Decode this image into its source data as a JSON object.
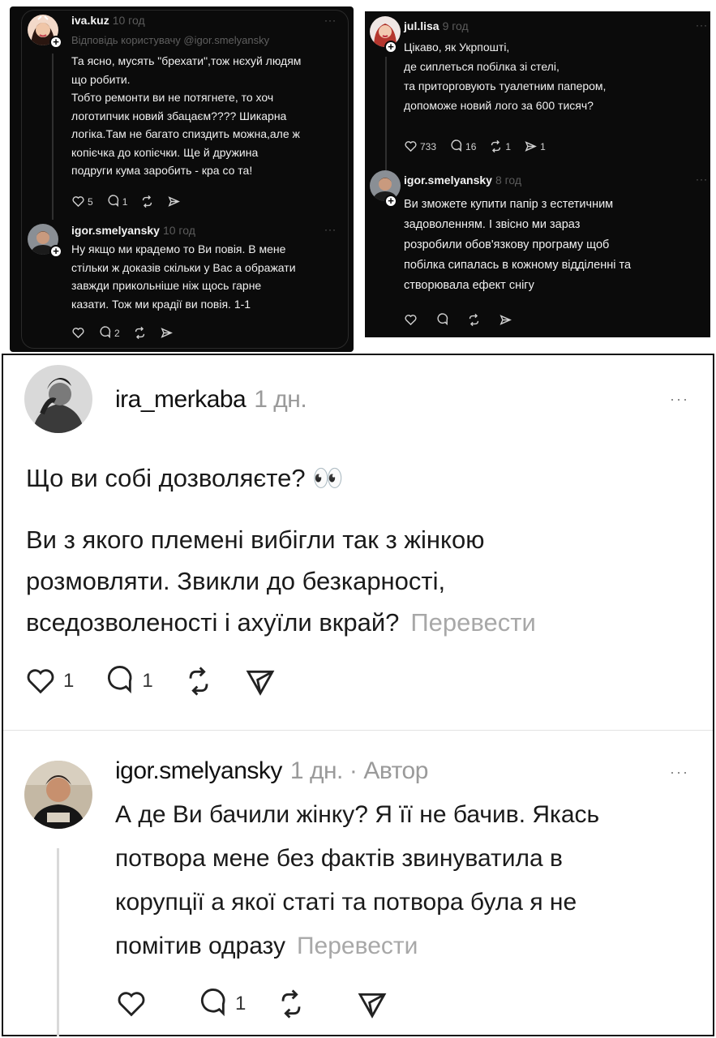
{
  "top_left": {
    "post1": {
      "username": "iva.kuz",
      "time": "10 год",
      "reply_to": "Відповідь користувачу @igor.smelyansky",
      "lines": [
        "Та ясно, мусять \"брехати\",тож нєхуй людям",
        "що робити.",
        "Тобто ремонти ви не потягнете, то хоч",
        "логотипчик новий збацаєм???? Шикарна",
        "логіка.Там не багато спиздить можна,але ж",
        "копієчка до копієчки. Ще й дружина",
        "подруги кума заробить - кра со та!"
      ],
      "likes": "5",
      "replies": "1",
      "more": "···"
    },
    "post2": {
      "username": "igor.smelyansky",
      "time": "10 год",
      "lines": [
        "Ну якщо ми крадемо то Ви повія. В мене",
        "стільки ж доказів скільки у Вас а ображати",
        "завжди прикольніше ніж щось гарне",
        "казати. Тож ми крадії ви повія. 1-1"
      ],
      "replies": "2",
      "more": "···"
    }
  },
  "top_right": {
    "post1": {
      "username": "jul.lisa",
      "time": "9 год",
      "lines": [
        "Цікаво, як Укрпошті,",
        "де сиплеться побілка зі стелі,",
        "та приторговують туалетним папером,",
        "допоможе новий лого за 600 тисяч?"
      ],
      "likes": "733",
      "replies": "16",
      "reposts": "1",
      "shares": "1",
      "more": "···"
    },
    "post2": {
      "username": "igor.smelyansky",
      "time": "8 год",
      "lines": [
        "Ви зможете купити папір з естетичним",
        "задоволенням. І звісно ми зараз",
        "розробили обов'язкову програму щоб",
        "побілка сипалась в кожному відділенні та",
        "створювала ефект снігу"
      ],
      "more": "···"
    }
  },
  "bottom": {
    "post1": {
      "username": "ira_merkaba",
      "time": "1 дн.",
      "line1": "Що ви собі дозволяєте? 👀",
      "para": [
        "Ви з якого племені вибігли так з жінкою",
        "розмовляти. Звикли до безкарності,",
        "вседозволеності і ахуїли вкрай?"
      ],
      "translate": "Перевести",
      "likes": "1",
      "replies": "1",
      "more": "···"
    },
    "post2": {
      "username": "igor.smelyansky",
      "time": "1 дн.",
      "separator": "·",
      "author": "Автор",
      "lines": [
        "А де Ви бачили жінку? Я її не бачив. Якась",
        "потвора мене без фактів звинуватила в",
        "корупції а якої статі та потвора була я не",
        "помітив одразу"
      ],
      "translate": "Перевести",
      "replies": "1",
      "more": "···"
    }
  },
  "colors": {
    "dark_bg": "#0b0b0b",
    "dark_text": "#f0f0f0",
    "dark_meta": "#5c5c5c",
    "light_text": "#1a1a1a",
    "light_meta": "#9a9a9a"
  },
  "icons": [
    "heart-icon",
    "comment-icon",
    "repost-icon",
    "share-icon",
    "plus-icon",
    "more-icon"
  ]
}
